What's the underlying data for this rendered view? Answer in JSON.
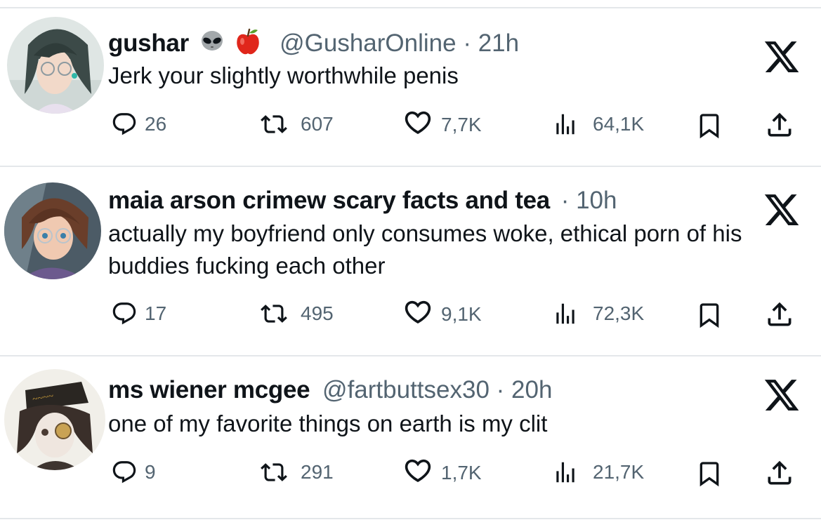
{
  "tweets": [
    {
      "name": "gushar",
      "emojis": [
        "alien-icon",
        "apple-icon"
      ],
      "handle": "@GusharOnline",
      "sep": "·",
      "time": "21h",
      "text": "Jerk your slightly worthwhile penis",
      "replies": "26",
      "retweets": "607",
      "likes": "7,7K",
      "views": "64,1K"
    },
    {
      "name": "maia arson crimew scary facts and tea",
      "handle": "",
      "sep": "·",
      "time": "10h",
      "text": "actually my boyfriend only consumes woke, ethical porn of his buddies fucking each other",
      "replies": "17",
      "retweets": "495",
      "likes": "9,1K",
      "views": "72,3K"
    },
    {
      "name": "ms wiener mcgee",
      "handle": "@fartbuttsex30",
      "sep": "·",
      "time": "20h",
      "text": "one of my favorite things on earth is my clit",
      "replies": "9",
      "retweets": "291",
      "likes": "1,7K",
      "views": "21,7K"
    }
  ],
  "colors": {
    "text": "#0f1419",
    "muted": "#536471",
    "divider": "#e4e7ea",
    "apple_red": "#e0261b"
  }
}
